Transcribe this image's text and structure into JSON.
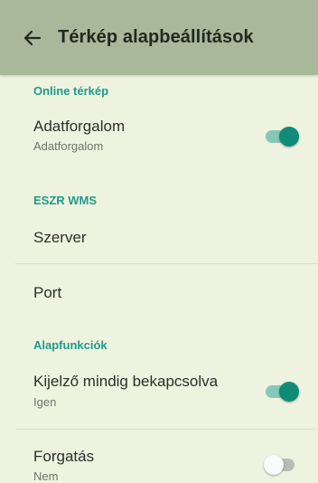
{
  "appbar": {
    "back_icon": "arrow-left-icon",
    "title": "Térkép alapbeállítások"
  },
  "sections": {
    "online": {
      "header": "Online térkép",
      "adatforgalom": {
        "title": "Adatforgalom",
        "summary": "Adatforgalom",
        "enabled": true
      }
    },
    "eszr": {
      "header": "ESZR WMS",
      "server": {
        "title": "Szerver"
      },
      "port": {
        "title": "Port"
      }
    },
    "alap": {
      "header": "Alapfunkciók",
      "screen_on": {
        "title": "Kijelző mindig bekapcsolva",
        "summary": "Igen",
        "enabled": true
      },
      "rotation": {
        "title": "Forgatás",
        "summary": "Nem",
        "enabled": false
      }
    }
  },
  "colors": {
    "accent": "#0f8b77",
    "appbar": "#a9b79a",
    "background": "#eef3e0"
  }
}
